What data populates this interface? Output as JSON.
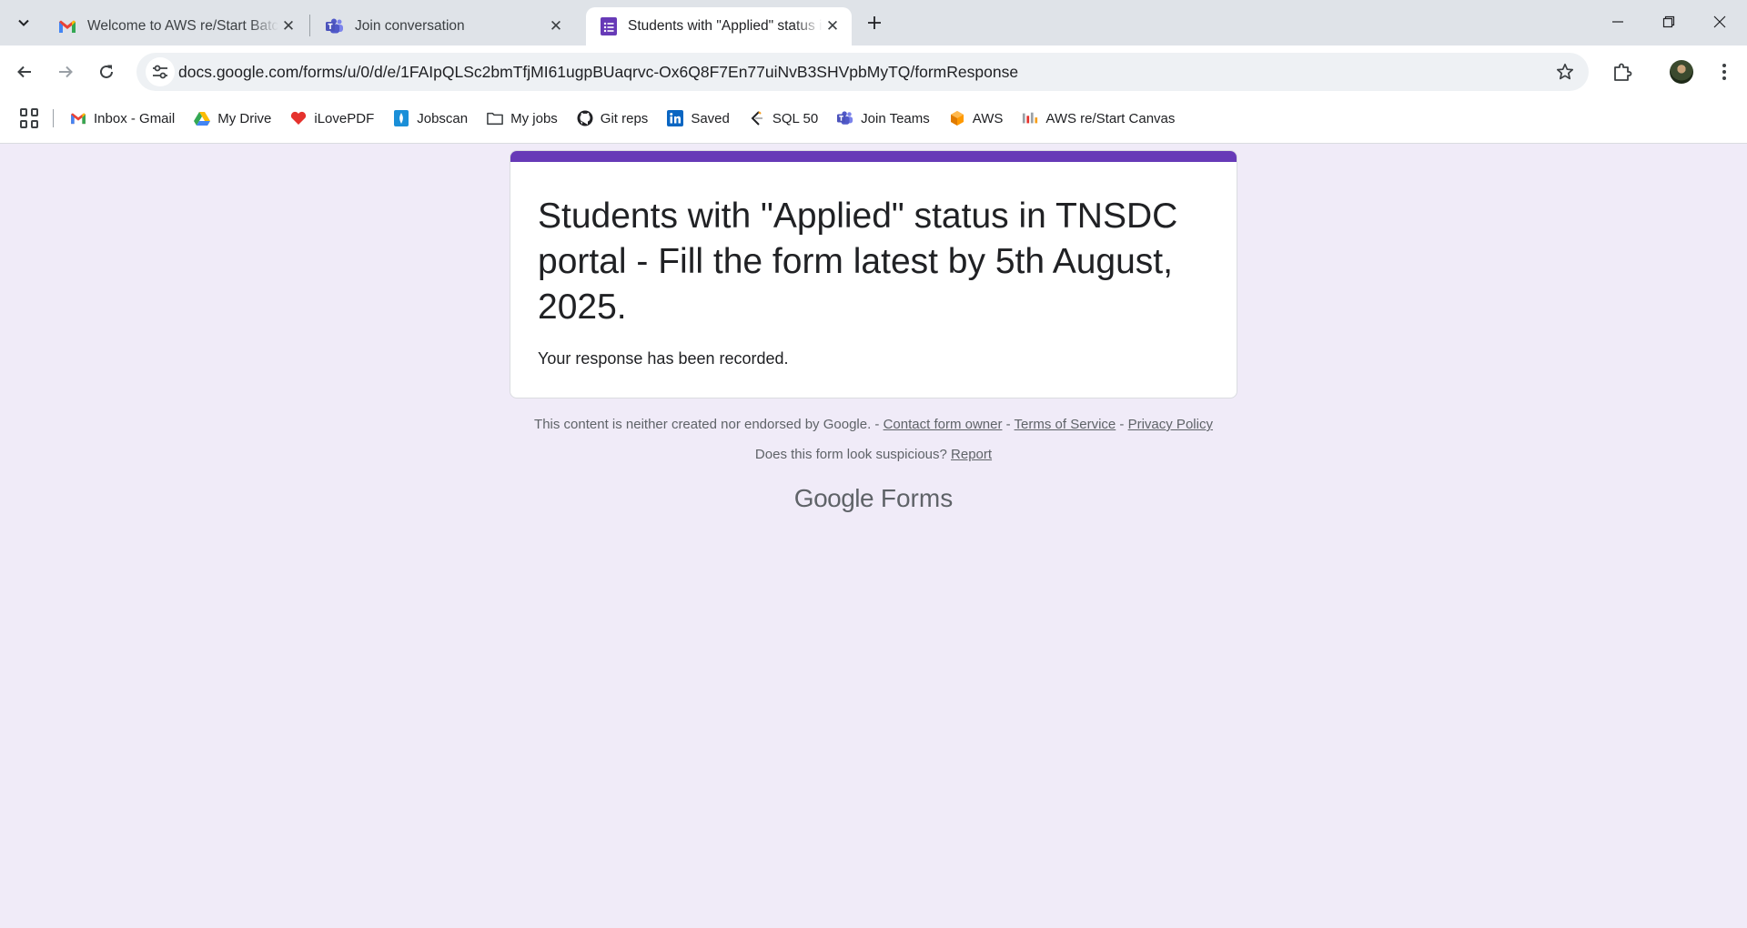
{
  "tabs": [
    {
      "title": "Welcome to AWS re/Start Batch",
      "icon": "gmail-icon",
      "close": "✕"
    },
    {
      "title": "Join conversation",
      "icon": "teams-icon",
      "close": "✕"
    },
    {
      "title": "Students with \"Applied\" status i",
      "icon": "google-forms-icon",
      "close": "✕",
      "active": true
    }
  ],
  "omnibox": {
    "url": "docs.google.com/forms/u/0/d/e/1FAIpQLSc2bmTfjMI61ugpBUaqrvc-Ox6Q8F7En77uiNvB3SHVpbMyTQ/formResponse"
  },
  "bookmarks": [
    {
      "label": "Inbox - Gmail",
      "icon": "gmail-icon"
    },
    {
      "label": "My Drive",
      "icon": "google-drive-icon"
    },
    {
      "label": "iLovePDF",
      "icon": "ilovepdf-icon"
    },
    {
      "label": "Jobscan",
      "icon": "jobscan-icon"
    },
    {
      "label": "My jobs",
      "icon": "folder-icon"
    },
    {
      "label": "Git reps",
      "icon": "github-icon"
    },
    {
      "label": "Saved",
      "icon": "linkedin-icon"
    },
    {
      "label": "SQL 50",
      "icon": "leetcode-icon"
    },
    {
      "label": "Join Teams",
      "icon": "teams-icon"
    },
    {
      "label": "AWS",
      "icon": "aws-icon"
    },
    {
      "label": "AWS re/Start Canvas",
      "icon": "canvas-icon"
    }
  ],
  "form": {
    "title": "Students with \"Applied\" status in TNSDC portal - Fill the form latest by 5th August, 2025.",
    "message": "Your response has been recorded.",
    "accent_color": "#673ab7"
  },
  "footer": {
    "disclaimer": "This content is neither created nor endorsed by Google.",
    "sep1": " - ",
    "contact": "Contact form owner",
    "sep2": " - ",
    "terms": "Terms of Service",
    "sep3": " - ",
    "privacy": "Privacy Policy",
    "suspicious": "Does this form look suspicious?",
    "report": "Report",
    "brand_google": "Google",
    "brand_forms": "Forms"
  }
}
